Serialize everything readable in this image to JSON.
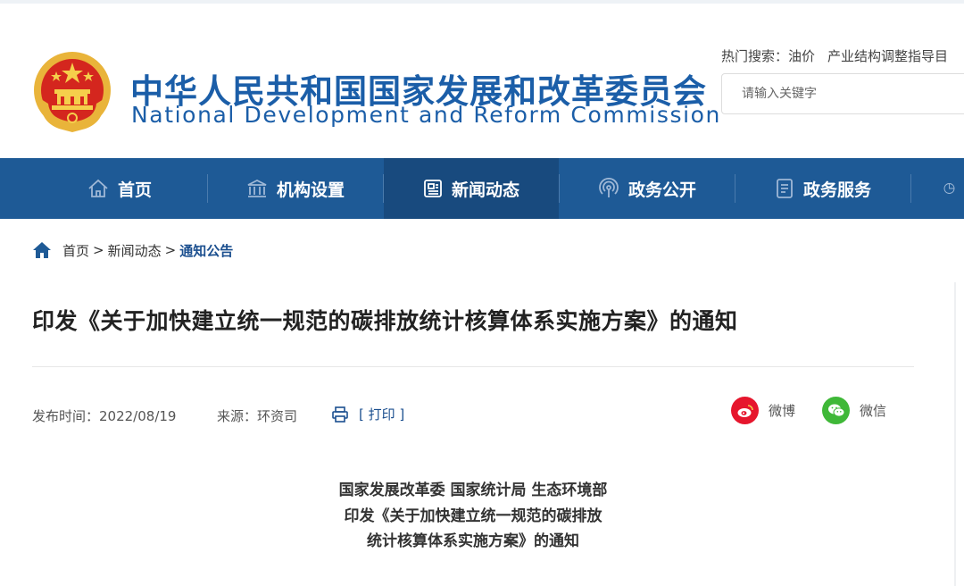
{
  "header": {
    "title_cn": "中华人民共和国国家发展和改革委员会",
    "title_en": "National Development and Reform Commission",
    "hot_search_label": "热门搜索：",
    "hot_search_items": [
      "油价",
      "产业结构调整指导目"
    ],
    "search_placeholder": "请输入关键字"
  },
  "nav": {
    "items": [
      {
        "label": "首页",
        "icon": "home-icon"
      },
      {
        "label": "机构设置",
        "icon": "institution-icon"
      },
      {
        "label": "新闻动态",
        "icon": "news-icon",
        "active": true
      },
      {
        "label": "政务公开",
        "icon": "broadcast-icon"
      },
      {
        "label": "政务服务",
        "icon": "document-icon"
      },
      {
        "label": "",
        "icon": "pie-chart-icon"
      }
    ]
  },
  "breadcrumb": {
    "items": [
      "首页",
      "新闻动态"
    ],
    "separator": ">",
    "current": "通知公告"
  },
  "article": {
    "title": "印发《关于加快建立统一规范的碳排放统计核算体系实施方案》的通知",
    "publish_time": "发布时间：2022/08/19",
    "source": "来源：环资司",
    "print_label": "[ 打印 ]",
    "share": [
      {
        "label": "微博",
        "icon": "weibo-icon",
        "color": "#e6162d"
      },
      {
        "label": "微信",
        "icon": "wechat-icon",
        "color": "#3fb838"
      }
    ],
    "body_lines": [
      "国家发展改革委 国家统计局 生态环境部",
      "印发《关于加快建立统一规范的碳排放",
      "统计核算体系实施方案》的通知"
    ]
  },
  "colors": {
    "brand_blue": "#1b5ea8",
    "nav_bg": "#1e5a96",
    "nav_active": "#184a7e"
  }
}
